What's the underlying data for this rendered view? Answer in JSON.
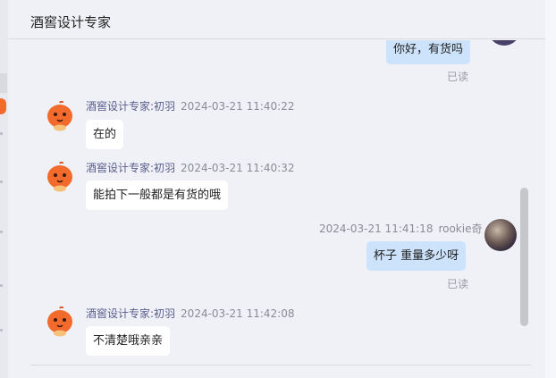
{
  "window": {
    "title": "酒窖设计专家"
  },
  "messages": [
    {
      "direction": "out",
      "text": "你好，有货吗",
      "status": "已读"
    },
    {
      "direction": "in",
      "sender": "酒窖设计专家:初羽",
      "time": "2024-03-21 11:40:22",
      "text": "在的"
    },
    {
      "direction": "in",
      "sender": "酒窖设计专家:初羽",
      "time": "2024-03-21 11:40:32",
      "text": "能拍下一般都是有货的哦"
    },
    {
      "direction": "out",
      "sender": "rookie奇",
      "time": "2024-03-21 11:41:18",
      "text": "杯子  重量多少呀",
      "status": "已读"
    },
    {
      "direction": "in",
      "sender": "酒窖设计专家:初羽",
      "time": "2024-03-21 11:42:08",
      "text": "不清楚哦亲亲"
    }
  ],
  "colors": {
    "incoming_bubble": "#ffffff",
    "outgoing_bubble": "#cde3fb",
    "sender_name": "#5a5d8f",
    "mascot": "#f26b2d"
  },
  "icons": {
    "agent_avatar": "orange-mascot-avatar",
    "user_avatar": "photo-avatar"
  }
}
